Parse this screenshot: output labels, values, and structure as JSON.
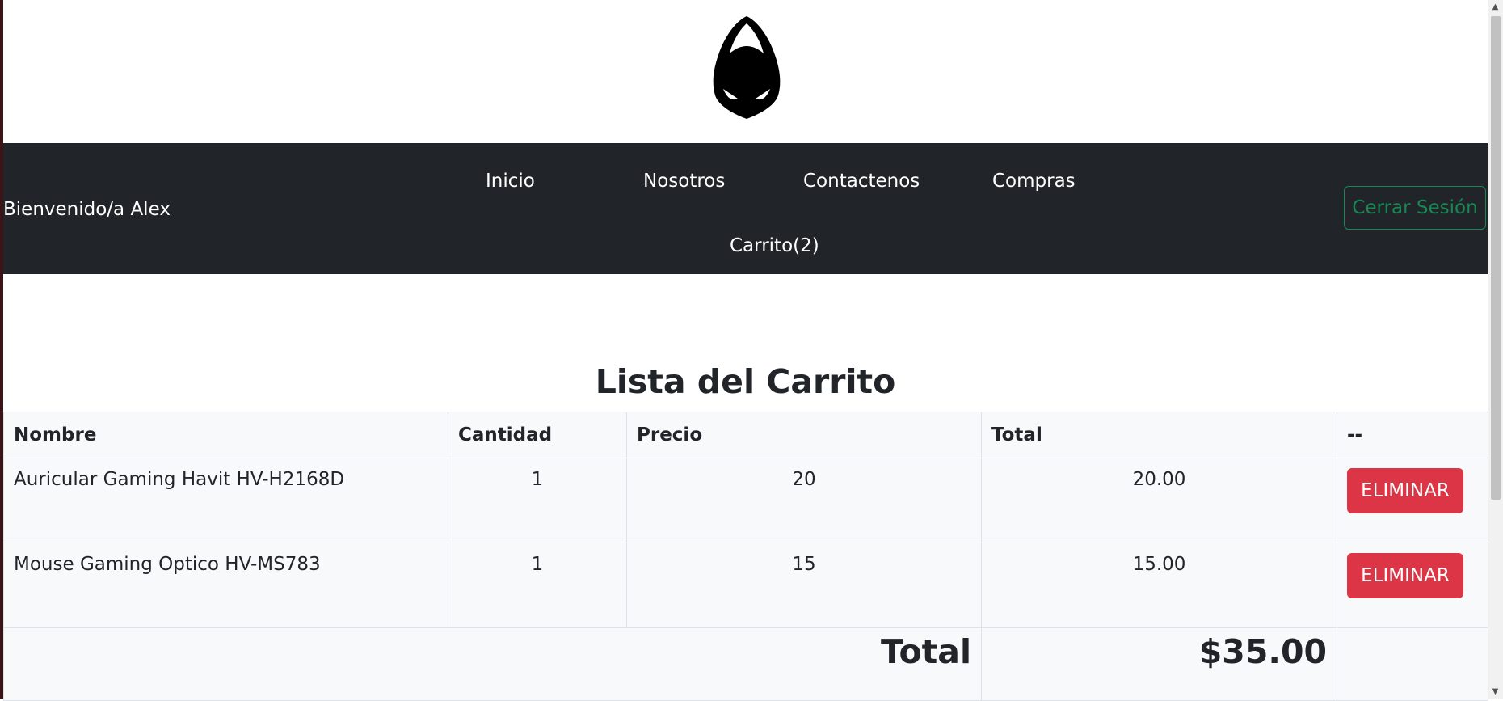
{
  "brand": {
    "logo_icon": "hooded-mask-logo-icon"
  },
  "navbar": {
    "welcome": "Bienvenido/a Alex",
    "links": [
      {
        "label": "Inicio"
      },
      {
        "label": "Nosotros"
      },
      {
        "label": "Contactenos"
      },
      {
        "label": "Compras"
      },
      {
        "label": "Carrito(2)"
      }
    ],
    "logout_label": "Cerrar Sesión"
  },
  "cart": {
    "title": "Lista del Carrito",
    "columns": [
      "Nombre",
      "Cantidad",
      "Precio",
      "Total",
      "--"
    ],
    "rows": [
      {
        "name": "Auricular Gaming Havit HV-H2168D",
        "quantity": "1",
        "price": "20",
        "total": "20.00",
        "action": "ELIMINAR"
      },
      {
        "name": "Mouse Gaming Optico HV-MS783",
        "quantity": "1",
        "price": "15",
        "total": "15.00",
        "action": "ELIMINAR"
      }
    ],
    "total_label": "Total",
    "total_value": "$35.00"
  },
  "colors": {
    "navbar_bg": "#212529",
    "danger": "#dc3545",
    "success_outline": "#198754",
    "table_bg": "#f8f9fa"
  }
}
